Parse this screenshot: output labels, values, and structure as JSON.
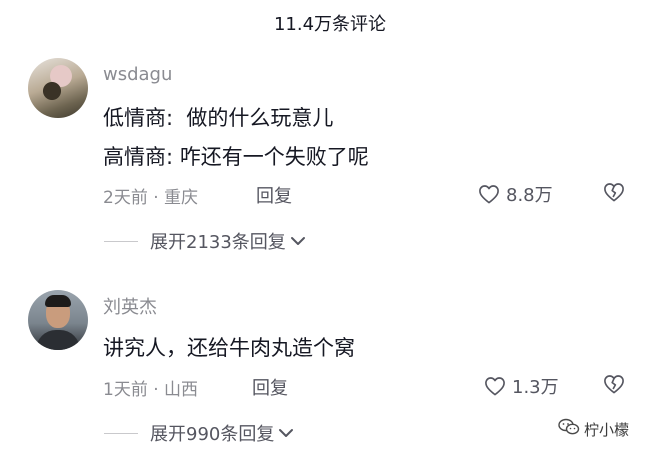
{
  "header": {
    "title": "11.4万条评论"
  },
  "comments": [
    {
      "username": "wsdagu",
      "lines": [
        "低情商:  做的什么玩意儿",
        "高情商: 咋还有一个失败了呢"
      ],
      "time": "2天前",
      "location": "重庆",
      "reply_label": "回复",
      "likes": "8.8万",
      "expand_label": "展开2133条回复"
    },
    {
      "username": "刘英杰",
      "lines": [
        "讲究人，还给牛肉丸造个窝"
      ],
      "time": "1天前",
      "location": "山西",
      "reply_label": "回复",
      "likes": "1.3万",
      "expand_label": "展开990条回复"
    }
  ],
  "watermark": {
    "text": "柠小檬",
    "icon": "wechat-icon"
  },
  "icons": {
    "like": "heart-icon",
    "dislike": "broken-heart-icon",
    "expand": "chevron-down-icon"
  },
  "colors": {
    "primary_text": "#161823",
    "secondary_text": "#8a8b91",
    "action_text": "#555660"
  }
}
